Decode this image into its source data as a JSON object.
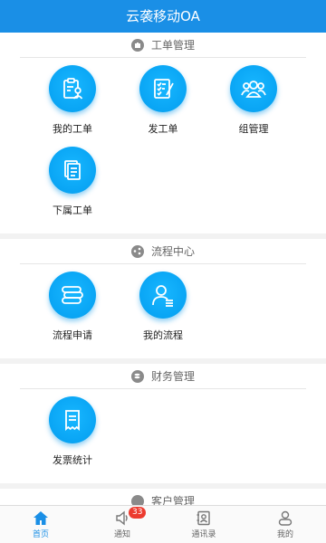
{
  "header": {
    "title": "云袭移动OA"
  },
  "sections": [
    {
      "title": "工单管理",
      "items": [
        {
          "label": "我的工单"
        },
        {
          "label": "发工单"
        },
        {
          "label": "组管理"
        },
        {
          "label": "下属工单"
        }
      ]
    },
    {
      "title": "流程中心",
      "items": [
        {
          "label": "流程申请"
        },
        {
          "label": "我的流程"
        }
      ]
    },
    {
      "title": "财务管理",
      "items": [
        {
          "label": "发票统计"
        }
      ]
    },
    {
      "title": "客户管理"
    }
  ],
  "tabbar": {
    "tabs": [
      {
        "label": "首页",
        "active": true
      },
      {
        "label": "通知",
        "badge": "33"
      },
      {
        "label": "通讯录"
      },
      {
        "label": "我的"
      }
    ],
    "colors": {
      "active": "#1a8fe6",
      "inactive": "#666666"
    }
  },
  "colors": {
    "header": "#1a8fe6",
    "tile": "#0aa6f5",
    "badge": "#ec3b2f"
  }
}
